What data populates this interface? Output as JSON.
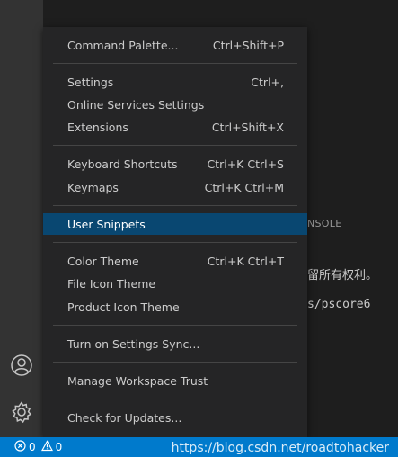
{
  "activity_bar": {
    "icons": [
      "account-icon",
      "manage-gear-icon"
    ]
  },
  "panel": {
    "tab_partial": "NSOLE",
    "line1_partial": "留所有权利。",
    "line2_partial": "s/pscore6"
  },
  "menu": {
    "items": [
      {
        "label": "Command Palette...",
        "shortcut": "Ctrl+Shift+P"
      },
      {
        "label": "Settings",
        "shortcut": "Ctrl+,"
      },
      {
        "label": "Online Services Settings",
        "shortcut": ""
      },
      {
        "label": "Extensions",
        "shortcut": "Ctrl+Shift+X"
      },
      {
        "label": "Keyboard Shortcuts",
        "shortcut": "Ctrl+K Ctrl+S"
      },
      {
        "label": "Keymaps",
        "shortcut": "Ctrl+K Ctrl+M"
      },
      {
        "label": "User Snippets",
        "shortcut": "",
        "selected": true
      },
      {
        "label": "Color Theme",
        "shortcut": "Ctrl+K Ctrl+T"
      },
      {
        "label": "File Icon Theme",
        "shortcut": ""
      },
      {
        "label": "Product Icon Theme",
        "shortcut": ""
      },
      {
        "label": "Turn on Settings Sync...",
        "shortcut": ""
      },
      {
        "label": "Manage Workspace Trust",
        "shortcut": ""
      },
      {
        "label": "Check for Updates...",
        "shortcut": ""
      }
    ]
  },
  "status_bar": {
    "errors": "0",
    "warnings": "0",
    "watermark": "https://blog.csdn.net/roadtohacker"
  },
  "colors": {
    "accent": "#007acc",
    "selection": "#094771",
    "menu_bg": "#252526"
  }
}
